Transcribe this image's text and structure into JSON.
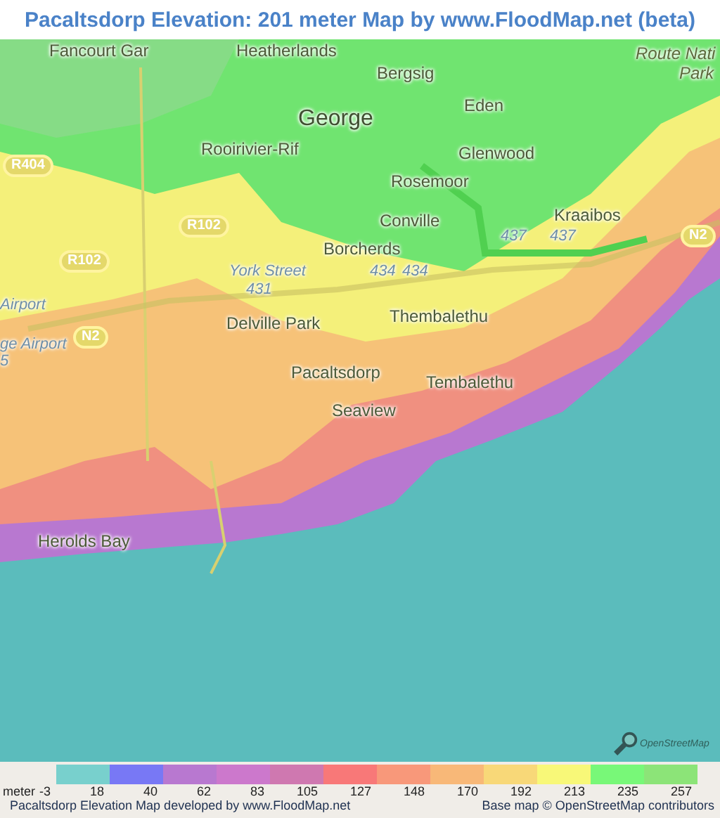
{
  "title": "Pacaltsdorp Elevation: 201 meter Map by www.FloodMap.net (beta)",
  "map": {
    "labels": [
      {
        "text": "Fancourt Gar",
        "kind": "place"
      },
      {
        "text": "Heatherlands",
        "kind": "place"
      },
      {
        "text": "Route Nati",
        "kind": "park"
      },
      {
        "text": "Park",
        "kind": "park"
      },
      {
        "text": "Bergsig",
        "kind": "place"
      },
      {
        "text": "Eden",
        "kind": "place"
      },
      {
        "text": "George",
        "kind": "city"
      },
      {
        "text": "Rooirivier-Rif",
        "kind": "place"
      },
      {
        "text": "Glenwood",
        "kind": "place"
      },
      {
        "text": "R404",
        "kind": "shield"
      },
      {
        "text": "Rosemoor",
        "kind": "place"
      },
      {
        "text": "Kraaibos",
        "kind": "place"
      },
      {
        "text": "R102",
        "kind": "shield"
      },
      {
        "text": "Conville",
        "kind": "place"
      },
      {
        "text": "437",
        "kind": "road"
      },
      {
        "text": "437",
        "kind": "road"
      },
      {
        "text": "N2",
        "kind": "shield"
      },
      {
        "text": "Borcherds",
        "kind": "place"
      },
      {
        "text": "R102",
        "kind": "shield"
      },
      {
        "text": "York Street",
        "kind": "road"
      },
      {
        "text": "434",
        "kind": "road"
      },
      {
        "text": "434",
        "kind": "road"
      },
      {
        "text": "431",
        "kind": "road"
      },
      {
        "text": "Airport",
        "kind": "road"
      },
      {
        "text": "Thembalethu",
        "kind": "place"
      },
      {
        "text": "Delville Park",
        "kind": "place"
      },
      {
        "text": "N2",
        "kind": "shield"
      },
      {
        "text": "ge Airport",
        "kind": "road"
      },
      {
        "text": "5",
        "kind": "road"
      },
      {
        "text": "Pacaltsdorp",
        "kind": "place"
      },
      {
        "text": "Tembalethu",
        "kind": "place"
      },
      {
        "text": "Seaview",
        "kind": "place"
      },
      {
        "text": "Herolds Bay",
        "kind": "place"
      }
    ],
    "logo": "OpenStreetMap"
  },
  "legend": {
    "unit": "meter",
    "min": "-3",
    "bins": [
      {
        "color": "#78d0cd",
        "upper": "18"
      },
      {
        "color": "#7878f5",
        "upper": "40"
      },
      {
        "color": "#b878d0",
        "upper": "62"
      },
      {
        "color": "#cc78cc",
        "upper": "83"
      },
      {
        "color": "#cf78b0",
        "upper": "105"
      },
      {
        "color": "#f87878",
        "upper": "127"
      },
      {
        "color": "#f8987a",
        "upper": "148"
      },
      {
        "color": "#f8b878",
        "upper": "170"
      },
      {
        "color": "#f8d878",
        "upper": "192"
      },
      {
        "color": "#f8f878",
        "upper": "213"
      },
      {
        "color": "#78f878",
        "upper": "235"
      },
      {
        "color": "#8ce478",
        "upper": "257"
      }
    ]
  },
  "footer": {
    "credit": "Pacaltsdorp Elevation Map developed by www.FloodMap.net",
    "attribution": "Base map © OpenStreetMap contributors"
  }
}
